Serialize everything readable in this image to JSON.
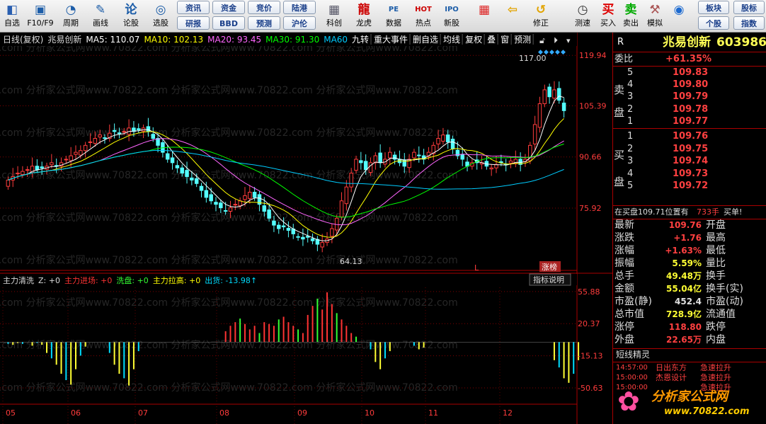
{
  "toolbar": {
    "items": [
      {
        "key": "zixuan",
        "label": "自选",
        "icon": "◧",
        "color": "#2a5fb0"
      },
      {
        "key": "f10",
        "label": "F10/F9",
        "icon": "▣",
        "color": "#1c5da8"
      },
      {
        "key": "zhouqi",
        "label": "周期",
        "icon": "◔",
        "color": "#1c5da8"
      },
      {
        "key": "huaxian",
        "label": "画线",
        "icon": "✎",
        "color": "#1c5da8"
      },
      {
        "key": "lungu",
        "label": "论股",
        "icon": "论",
        "color": "#1c5da8"
      },
      {
        "key": "xuangu",
        "label": "选股",
        "icon": "◎",
        "color": "#1c5da8"
      },
      {
        "key": "kechuang",
        "label": "科创",
        "icon": "▦",
        "color": "#556"
      },
      {
        "key": "longhu",
        "label": "龙虎",
        "icon": "龍",
        "color": "#c00"
      },
      {
        "key": "shuju",
        "label": "数据",
        "icon": "PE",
        "color": "#1c5da8"
      },
      {
        "key": "redian",
        "label": "热点",
        "icon": "HOT",
        "color": "#c00"
      },
      {
        "key": "xingu",
        "label": "新股",
        "icon": "IPO",
        "color": "#1c5da8"
      },
      {
        "key": "board",
        "label": "",
        "icon": "▦",
        "color": "#d22"
      },
      {
        "key": "back",
        "label": "",
        "icon": "⇦",
        "color": "#e2a400"
      },
      {
        "key": "xiuzheng",
        "label": "修正",
        "icon": "↺",
        "color": "#e2a400"
      },
      {
        "key": "cesu",
        "label": "测速",
        "icon": "◷",
        "color": "#333"
      },
      {
        "key": "mairu",
        "label": "买入",
        "icon": "买",
        "color": "#d00"
      },
      {
        "key": "maichu",
        "label": "卖出",
        "icon": "卖",
        "color": "#0a0"
      },
      {
        "key": "moni",
        "label": "模拟",
        "icon": "⚒",
        "color": "#a55"
      },
      {
        "key": "globe",
        "label": "",
        "icon": "◉",
        "color": "#1c6ad0"
      }
    ],
    "buttons": {
      "zixun": "资讯",
      "zijin": "资金",
      "jingjia": "竞价",
      "lugang": "陆港",
      "yanbao": "研报",
      "bbd": "BBD",
      "yuce": "预测",
      "hulun": "沪伦",
      "bankuai": "板块",
      "gubiao": "股标",
      "gegu": "个股",
      "zhishu": "指数"
    }
  },
  "main": {
    "title": "日线(复权)",
    "name": "兆易创新",
    "ma": [
      {
        "label": "MA5: 110.07",
        "color": "#ffffff"
      },
      {
        "label": "MA10: 102.13",
        "color": "#ffff00"
      },
      {
        "label": "MA20: 93.45",
        "color": "#ff66ff"
      },
      {
        "label": "MA30: 91.30",
        "color": "#00ff00"
      },
      {
        "label": "MA60",
        "color": "#00ccff"
      }
    ],
    "tabs": [
      "九转",
      "重大事件",
      "删自选",
      "均线",
      "复权",
      "叠",
      "窗",
      "预测"
    ],
    "high_label": "117.00",
    "low_label": "64.13",
    "zt_label": "涨榜",
    "l_label": "L",
    "watermark": "22.com 分析家公式网www.70822.com 分析家公式网www.70822.com 分析家公式网www.70822.com"
  },
  "indicator": {
    "name": "主力清洗",
    "z": "Z: +0",
    "parts": [
      {
        "label": "主力进场: +0",
        "color": "#ff3333"
      },
      {
        "label": "洗盘: +0",
        "color": "#33ff33"
      },
      {
        "label": "主力拉高: +0",
        "color": "#ffff00"
      },
      {
        "label": "出货: -13.98↑",
        "color": "#00ddff"
      }
    ],
    "button": "指标说明"
  },
  "axis": {
    "price_ticks": [
      "119.94",
      "105.39",
      "90.66",
      "75.92"
    ],
    "ind_ticks": [
      "55.88",
      "20.37",
      "-15.13",
      "-50.63"
    ],
    "months": [
      "05",
      "06",
      "07",
      "08",
      "09",
      "10",
      "11",
      "12"
    ]
  },
  "chart_data": {
    "type": "candlestick",
    "x": [
      "05",
      "06",
      "07",
      "08",
      "09",
      "10",
      "11",
      "12"
    ],
    "ylim": [
      64.13,
      119.94
    ],
    "close": [
      84,
      85,
      86,
      86.5,
      87,
      88,
      87,
      87.5,
      88,
      89,
      88,
      89,
      90,
      91,
      92,
      92.5,
      94,
      95,
      96,
      97,
      96,
      97.5,
      98,
      97.5,
      98,
      99,
      98,
      98.5,
      99,
      98,
      96,
      94,
      92,
      90,
      89,
      87.5,
      86,
      85,
      84,
      83,
      81,
      79,
      78,
      77,
      76,
      75,
      76,
      77,
      78,
      79.5,
      80.5,
      79,
      77,
      75,
      73,
      71,
      70,
      70.5,
      69.5,
      68.5,
      67.5,
      67,
      67.5,
      66.5,
      65.5,
      66,
      67,
      70,
      73,
      78,
      82,
      86,
      90,
      89,
      87,
      89,
      91,
      89,
      90,
      92,
      90,
      89,
      88,
      90,
      92,
      91,
      90,
      92,
      94,
      96,
      97,
      95,
      93,
      91,
      90,
      88,
      89,
      89,
      89,
      88,
      87.5,
      88.5,
      89,
      88.5,
      89.5,
      90,
      88.5,
      90,
      94,
      100,
      106,
      110,
      108,
      110,
      107,
      104
    ],
    "volume_ind": [
      -2,
      -3,
      -1,
      -2,
      0,
      -4,
      -1,
      -3,
      -12,
      -18,
      -25,
      -35,
      -42,
      -47,
      -30,
      -15,
      -5,
      0,
      0,
      0,
      0,
      -12,
      -25,
      -35,
      -40,
      -48,
      -30,
      -10,
      0,
      0,
      0,
      0,
      0,
      0,
      0,
      0,
      0,
      0,
      0,
      0,
      0,
      0,
      0,
      0,
      0,
      12,
      18,
      22,
      26,
      20,
      14,
      18,
      10,
      22,
      20,
      18,
      25,
      28,
      22,
      18,
      14,
      10,
      30,
      40,
      48,
      36,
      55,
      42,
      32,
      25,
      18,
      10,
      6,
      0,
      0,
      -8,
      -22,
      -30,
      -18,
      -10,
      0,
      0,
      0,
      0,
      -4,
      -8,
      -6,
      0,
      0,
      0,
      0,
      0,
      0,
      0,
      0,
      0,
      0,
      0,
      0,
      0,
      0,
      0,
      0,
      0,
      0,
      0,
      0,
      0,
      0,
      0,
      0,
      0,
      0,
      -20,
      -28,
      -40,
      -45,
      -35,
      -20
    ]
  },
  "right_panel": {
    "code": "R",
    "name": "兆易创新",
    "code_no": "603986",
    "weibi_label": "委比",
    "weibi_value": "+61.35%",
    "sell": [
      {
        "lvl": "5",
        "price": "109.83"
      },
      {
        "lvl": "4",
        "price": "109.80"
      },
      {
        "lvl": "3",
        "price": "109.79"
      },
      {
        "lvl": "2",
        "price": "109.78"
      },
      {
        "lvl": "1",
        "price": "109.77"
      }
    ],
    "buy": [
      {
        "lvl": "1",
        "price": "109.76"
      },
      {
        "lvl": "2",
        "price": "109.75"
      },
      {
        "lvl": "3",
        "price": "109.74"
      },
      {
        "lvl": "4",
        "price": "109.73"
      },
      {
        "lvl": "5",
        "price": "109.72"
      }
    ],
    "sell_label": [
      "卖",
      "盘"
    ],
    "buy_label": [
      "买",
      "盘"
    ],
    "zaimai": "在买盘109.71位置有",
    "zaimai_num": "733手",
    "zaimai_tail": "买单!",
    "stats": [
      {
        "l": "最新",
        "v": "109.76",
        "c": "#ff4040",
        "l2": "开盘"
      },
      {
        "l": "涨跌",
        "v": "+1.76",
        "c": "#ff4040",
        "l2": "最高"
      },
      {
        "l": "涨幅",
        "v": "+1.63%",
        "c": "#ff4040",
        "l2": "最低"
      },
      {
        "l": "振幅",
        "v": "5.59%",
        "c": "#ffff33",
        "l2": "量比"
      },
      {
        "l": "总手",
        "v": "49.48万",
        "c": "#ffff33",
        "l2": "换手"
      },
      {
        "l": "金额",
        "v": "55.04亿",
        "c": "#ffff33",
        "l2": "换手(实)"
      },
      {
        "l": "市盈(静)",
        "v": "452.4",
        "c": "#e0e0e0",
        "l2": "市盈(动)"
      },
      {
        "l": "总市值",
        "v": "728.9亿",
        "c": "#ffff33",
        "l2": "流通值"
      },
      {
        "l": "涨停",
        "v": "118.80",
        "c": "#ff4040",
        "l2": "跌停"
      },
      {
        "l": "外盘",
        "v": "22.65万",
        "c": "#ff4040",
        "l2": "内盘"
      }
    ],
    "sjgl": "短线精灵",
    "news": [
      {
        "t": "14:57:00",
        "s": "日出东方",
        "e": "急速拉升"
      },
      {
        "t": "15:00:00",
        "s": "杰恩设计",
        "e": "急速拉升"
      },
      {
        "t": "15:00:00",
        "s": "",
        "e": "急速拉升"
      }
    ],
    "logo": "分析家公式网",
    "logo_url": "www.70822.com"
  }
}
